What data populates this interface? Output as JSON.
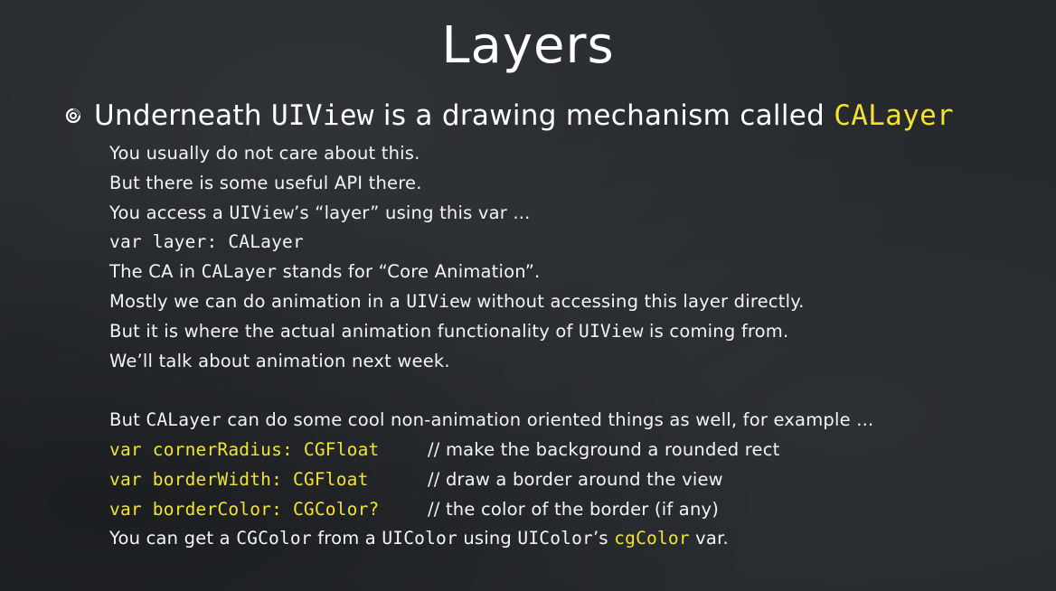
{
  "title": "Layers",
  "bullet": {
    "prefix": "Underneath ",
    "code1": "UIView",
    "middle": " is a drawing mechanism called ",
    "code2": "CALayer"
  },
  "lines": {
    "l1": "You usually do not care about this.",
    "l2": "But there is some useful API there.",
    "l3_a": "You access a ",
    "l3_code": "UIView",
    "l3_b": "’s “layer” using this var ...",
    "l4_code": "var layer: CALayer",
    "l5_a": "The CA in ",
    "l5_code": "CALayer",
    "l5_b": " stands for “Core Animation”.",
    "l6_a": "Mostly we can do animation in a ",
    "l6_code": "UIView",
    "l6_b": " without accessing this layer directly.",
    "l7_a": "But it is where the actual animation functionality of ",
    "l7_code": "UIView",
    "l7_b": " is coming from.",
    "l8": "We’ll talk about animation next week.",
    "l9_a": "But ",
    "l9_code": "CALayer",
    "l9_b": " can do some cool non-animation oriented things as well, for example ...",
    "l10_code": "var cornerRadius: CGFloat",
    "l10_comment": "// make the background a rounded rect",
    "l11_code": "var borderWidth: CGFloat",
    "l11_comment": "// draw a border around the view",
    "l12_code": "var borderColor: CGColor?",
    "l12_comment": "// the color of the border (if any)",
    "l13_a": "You can get a ",
    "l13_code1": "CGColor",
    "l13_b": " from a ",
    "l13_code2": "UIColor",
    "l13_c": " using ",
    "l13_code3": "UIColor",
    "l13_d": "’s ",
    "l13_code4": "cgColor",
    "l13_e": " var."
  },
  "colors": {
    "background": "#25282c",
    "text": "#f4f4f4",
    "code_highlight": "#f3e331"
  },
  "icons": {
    "bullet": "spiral-bullet-icon"
  }
}
